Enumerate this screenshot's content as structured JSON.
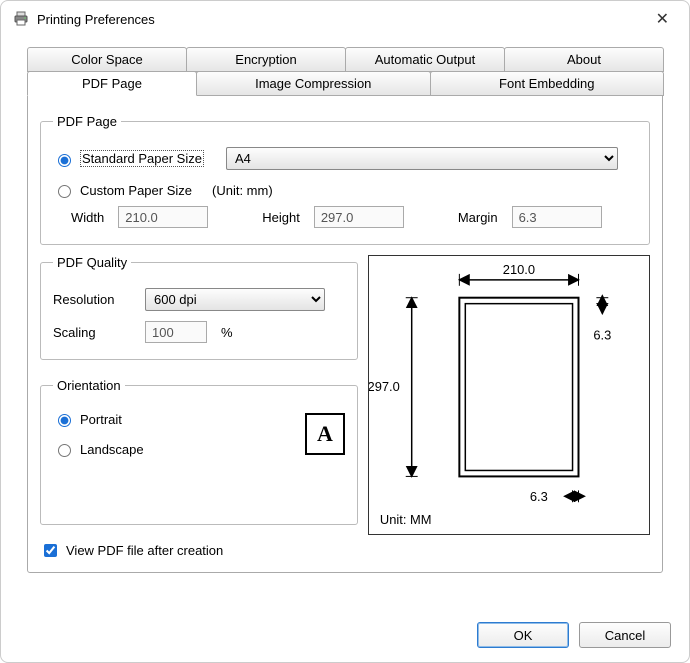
{
  "window": {
    "title": "Printing Preferences"
  },
  "tabs": {
    "row1": [
      "Color Space",
      "Encryption",
      "Automatic Output",
      "About"
    ],
    "row2": [
      "PDF Page",
      "Image Compression",
      "Font Embedding"
    ],
    "active": "PDF Page"
  },
  "pdfPage": {
    "legend": "PDF Page",
    "standardRadio": "Standard Paper Size",
    "customRadio": "Custom Paper Size",
    "unitHint": "(Unit: mm)",
    "paperSize": "A4",
    "widthLabel": "Width",
    "widthValue": "210.0",
    "heightLabel": "Height",
    "heightValue": "297.0",
    "marginLabel": "Margin",
    "marginValue": "6.3"
  },
  "quality": {
    "legend": "PDF Quality",
    "resolutionLabel": "Resolution",
    "resolutionValue": "600 dpi",
    "scalingLabel": "Scaling",
    "scalingValue": "100",
    "scalingUnit": "%"
  },
  "orientation": {
    "legend": "Orientation",
    "portrait": "Portrait",
    "landscape": "Landscape",
    "selected": "portrait"
  },
  "preview": {
    "width": "210.0",
    "height": "297.0",
    "marginV": "6.3",
    "marginH": "6.3",
    "unitLabel": "Unit: MM"
  },
  "viewAfter": {
    "label": "View PDF file after creation",
    "checked": true
  },
  "buttons": {
    "ok": "OK",
    "cancel": "Cancel"
  }
}
